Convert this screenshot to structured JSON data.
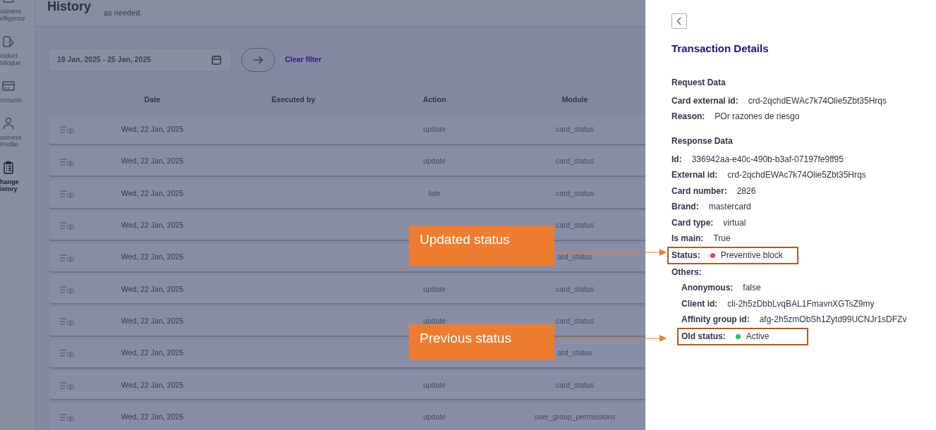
{
  "sidebar": {
    "items": [
      {
        "lines": [
          "usiness",
          "elligence"
        ],
        "selected": false
      },
      {
        "lines": [
          "roduct",
          "talogue"
        ],
        "selected": false
      },
      {
        "lines": [
          "ccounts"
        ],
        "selected": false
      },
      {
        "lines": [
          "usiness",
          "Profile"
        ],
        "selected": false
      },
      {
        "lines": [
          "hange",
          "istory"
        ],
        "selected": true
      }
    ]
  },
  "header": {
    "title": "History",
    "description": "as needed."
  },
  "filter": {
    "date_range": "19 Jan, 2025 - 25 Jan, 2025",
    "clear": "Clear filter"
  },
  "table": {
    "columns": [
      "Date",
      "Executed by",
      "Action",
      "Module"
    ],
    "rows": [
      {
        "date": "Wed, 22 Jan, 2025",
        "action": "update",
        "module": "card_status"
      },
      {
        "date": "Wed, 22 Jan, 2025",
        "action": "update",
        "module": "card_status"
      },
      {
        "date": "Wed, 22 Jan, 2025",
        "action": "late",
        "module": "card_status"
      },
      {
        "date": "Wed, 22 Jan, 2025",
        "module": "card_status"
      },
      {
        "date": "Wed, 22 Jan, 2025",
        "module": "ard_status"
      },
      {
        "date": "Wed, 22 Jan, 2025",
        "action": "update",
        "module": "card_status"
      },
      {
        "date": "Wed, 22 Jan, 2025",
        "action": "update",
        "module": "card_status"
      },
      {
        "date": "Wed, 22 Jan, 2025",
        "module": "ard_status"
      },
      {
        "date": "Wed, 22 Jan, 2025",
        "action": "update",
        "module": "card_status"
      },
      {
        "date": "Wed, 22 Jan, 2025",
        "action": "update",
        "module": "user_group_permissions"
      }
    ]
  },
  "details": {
    "title": "Transaction Details",
    "sections": [
      {
        "heading": "Request Data",
        "fields": [
          {
            "label": "Card external id:",
            "value": "crd-2qchdEWAc7k74Olie5Zbt35Hrqs"
          },
          {
            "label": "Reason:",
            "value": "POr razones de riesgo"
          }
        ]
      },
      {
        "heading": "Response Data",
        "fields": [
          {
            "label": "Id:",
            "value": "336942aa-e40c-490b-b3af-07197fe9ff95"
          },
          {
            "label": "External id:",
            "value": "crd-2qchdEWAc7k74Olie5Zbt35Hrqs"
          },
          {
            "label": "Card number:",
            "value": "2826"
          },
          {
            "label": "Brand:",
            "value": "mastercard"
          },
          {
            "label": "Card type:",
            "value": "virtual"
          },
          {
            "label": "Is main:",
            "value": "True"
          },
          {
            "label": "Status:",
            "value": "Preventive block",
            "color": "#f0405a",
            "highlighted": true
          },
          {
            "label": "Others:",
            "children": [
              {
                "label": "Anonymous:",
                "value": "false"
              },
              {
                "label": "Client id:",
                "value": "cli-2h5zDbbLvqBAL1FmavnXGTsZ9my"
              },
              {
                "label": "Affinity group id:",
                "value": "afg-2h5zmObSh1Zytd99UCNJr1sDFZv"
              },
              {
                "label": "Old status:",
                "value": "Active",
                "color": "#22c55e",
                "highlighted": true
              }
            ]
          }
        ]
      }
    ]
  },
  "callouts": [
    {
      "text": "Updated status"
    },
    {
      "text": "Previous status"
    }
  ]
}
